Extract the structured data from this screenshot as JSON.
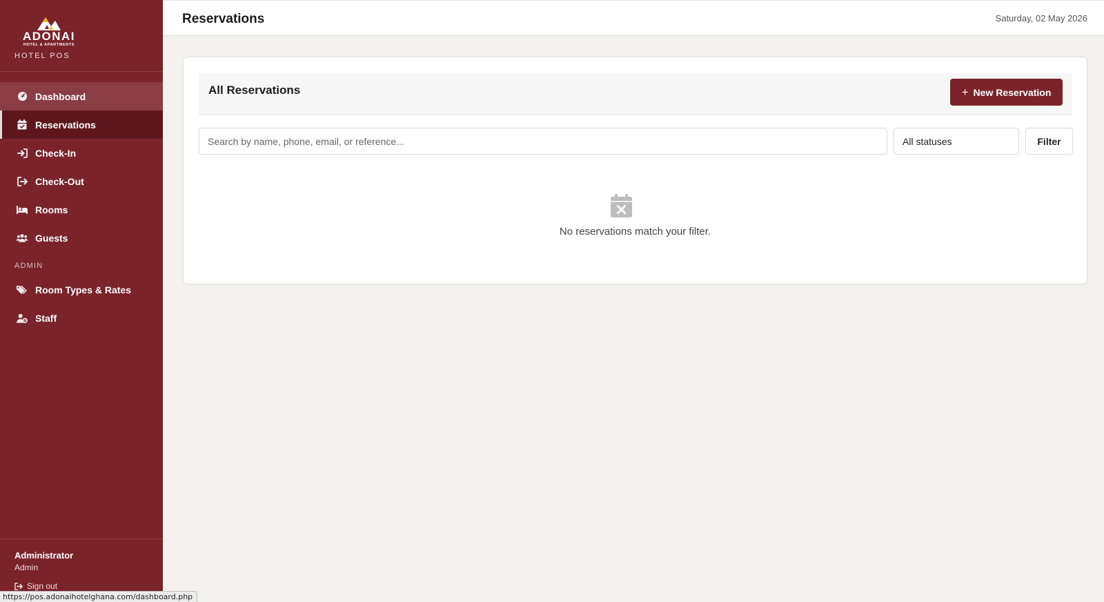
{
  "brand": {
    "logo_word": "ADONAI",
    "logo_sub": "HOTEL & APARTMENTS",
    "tag": "HOTEL POS"
  },
  "sidebar": {
    "items": [
      {
        "label": "Dashboard",
        "icon": "gauge-icon"
      },
      {
        "label": "Reservations",
        "icon": "calendar-check-icon"
      },
      {
        "label": "Check-In",
        "icon": "sign-in-icon"
      },
      {
        "label": "Check-Out",
        "icon": "sign-out-icon"
      },
      {
        "label": "Rooms",
        "icon": "bed-icon"
      },
      {
        "label": "Guests",
        "icon": "users-icon"
      }
    ],
    "section_label": "ADMIN",
    "admin_items": [
      {
        "label": "Room Types & Rates",
        "icon": "tags-icon"
      },
      {
        "label": "Staff",
        "icon": "user-gear-icon"
      }
    ],
    "active": "Reservations"
  },
  "user": {
    "name": "Administrator",
    "role": "Admin",
    "signout_label": "Sign out"
  },
  "header": {
    "title": "Reservations",
    "date": "Saturday, 02 May 2026"
  },
  "card": {
    "title": "All Reservations",
    "new_button_label": "New Reservation",
    "search_placeholder": "Search by name, phone, email, or reference...",
    "status_select": "All statuses",
    "filter_label": "Filter",
    "empty_message": "No reservations match your filter."
  },
  "status_bar_url": "https://pos.adonaihotelghana.com/dashboard.php",
  "colors": {
    "brand": "#7a2329",
    "brand_dark": "#5d171c",
    "background": "#f3f2ef"
  }
}
